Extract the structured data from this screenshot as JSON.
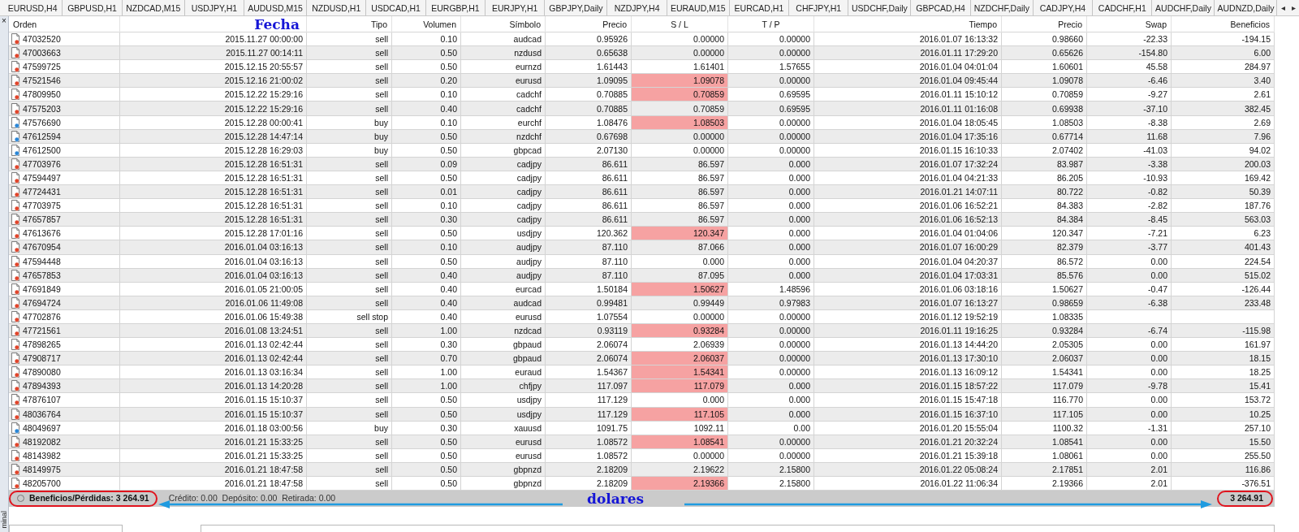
{
  "tabs": [
    {
      "label": "EURUSD,H4"
    },
    {
      "label": "GBPUSD,H1"
    },
    {
      "label": "NZDCAD,M15"
    },
    {
      "label": "USDJPY,H1"
    },
    {
      "label": "AUDUSD,M15"
    },
    {
      "label": "NZDUSD,H1"
    },
    {
      "label": "USDCAD,H1"
    },
    {
      "label": "EURGBP,H1"
    },
    {
      "label": "EURJPY,H1"
    },
    {
      "label": "GBPJPY,Daily"
    },
    {
      "label": "NZDJPY,H4"
    },
    {
      "label": "EURAUD,M15"
    },
    {
      "label": "EURCAD,H1"
    },
    {
      "label": "CHFJPY,H1"
    },
    {
      "label": "USDCHF,Daily"
    },
    {
      "label": "GBPCAD,H4"
    },
    {
      "label": "NZDCHF,Daily"
    },
    {
      "label": "CADJPY,H4"
    },
    {
      "label": "CADCHF,H1"
    },
    {
      "label": "AUDCHF,Daily"
    },
    {
      "label": "AUDNZD,Daily"
    }
  ],
  "tab_scroll": [
    "◂",
    "▸"
  ],
  "panel_close": "×",
  "panel_title": "minal",
  "columns": [
    {
      "label": "Orden",
      "annotated": false
    },
    {
      "label": "Fecha",
      "annotated": true
    },
    {
      "label": "Tipo",
      "annotated": false
    },
    {
      "label": "Volumen",
      "annotated": false
    },
    {
      "label": "Símbolo",
      "annotated": false
    },
    {
      "label": "Precio",
      "annotated": false
    },
    {
      "label": "S / L",
      "annotated": false
    },
    {
      "label": "T / P",
      "annotated": false
    },
    {
      "label": "Tiempo",
      "annotated": false
    },
    {
      "label": "Precio",
      "annotated": false
    },
    {
      "label": "Swap",
      "annotated": false
    },
    {
      "label": "Beneficios",
      "annotated": false
    }
  ],
  "rows": [
    {
      "kind": "sell",
      "sl_highlighted": false,
      "cells": [
        "47032520",
        "2015.11.27 00:00:00",
        "sell",
        "0.10",
        "audcad",
        "0.95926",
        "0.00000",
        "0.00000",
        "2016.01.07 16:13:32",
        "0.98660",
        "-22.33",
        "-194.15"
      ]
    },
    {
      "kind": "sell",
      "sl_highlighted": false,
      "cells": [
        "47003663",
        "2015.11.27 00:14:11",
        "sell",
        "0.50",
        "nzdusd",
        "0.65638",
        "0.00000",
        "0.00000",
        "2016.01.11 17:29:20",
        "0.65626",
        "-154.80",
        "6.00"
      ]
    },
    {
      "kind": "sell",
      "sl_highlighted": false,
      "cells": [
        "47599725",
        "2015.12.15 20:55:57",
        "sell",
        "0.50",
        "eurnzd",
        "1.61443",
        "1.61401",
        "1.57655",
        "2016.01.04 04:01:04",
        "1.60601",
        "45.58",
        "284.97"
      ]
    },
    {
      "kind": "sell",
      "sl_highlighted": true,
      "cells": [
        "47521546",
        "2015.12.16 21:00:02",
        "sell",
        "0.20",
        "eurusd",
        "1.09095",
        "1.09078",
        "0.00000",
        "2016.01.04 09:45:44",
        "1.09078",
        "-6.46",
        "3.40"
      ]
    },
    {
      "kind": "sell",
      "sl_highlighted": true,
      "cells": [
        "47809950",
        "2015.12.22 15:29:16",
        "sell",
        "0.10",
        "cadchf",
        "0.70885",
        "0.70859",
        "0.69595",
        "2016.01.11 15:10:12",
        "0.70859",
        "-9.27",
        "2.61"
      ]
    },
    {
      "kind": "sell",
      "sl_highlighted": false,
      "cells": [
        "47575203",
        "2015.12.22 15:29:16",
        "sell",
        "0.40",
        "cadchf",
        "0.70885",
        "0.70859",
        "0.69595",
        "2016.01.11 01:16:08",
        "0.69938",
        "-37.10",
        "382.45"
      ]
    },
    {
      "kind": "buy",
      "sl_highlighted": true,
      "cells": [
        "47576690",
        "2015.12.28 00:00:41",
        "buy",
        "0.10",
        "eurchf",
        "1.08476",
        "1.08503",
        "0.00000",
        "2016.01.04 18:05:45",
        "1.08503",
        "-8.38",
        "2.69"
      ]
    },
    {
      "kind": "buy",
      "sl_highlighted": false,
      "cells": [
        "47612594",
        "2015.12.28 14:47:14",
        "buy",
        "0.50",
        "nzdchf",
        "0.67698",
        "0.00000",
        "0.00000",
        "2016.01.04 17:35:16",
        "0.67714",
        "11.68",
        "7.96"
      ]
    },
    {
      "kind": "buy",
      "sl_highlighted": false,
      "cells": [
        "47612500",
        "2015.12.28 16:29:03",
        "buy",
        "0.50",
        "gbpcad",
        "2.07130",
        "0.00000",
        "0.00000",
        "2016.01.15 16:10:33",
        "2.07402",
        "-41.03",
        "94.02"
      ]
    },
    {
      "kind": "sell",
      "sl_highlighted": false,
      "cells": [
        "47703976",
        "2015.12.28 16:51:31",
        "sell",
        "0.09",
        "cadjpy",
        "86.611",
        "86.597",
        "0.000",
        "2016.01.07 17:32:24",
        "83.987",
        "-3.38",
        "200.03"
      ]
    },
    {
      "kind": "sell",
      "sl_highlighted": false,
      "cells": [
        "47594497",
        "2015.12.28 16:51:31",
        "sell",
        "0.50",
        "cadjpy",
        "86.611",
        "86.597",
        "0.000",
        "2016.01.04 04:21:33",
        "86.205",
        "-10.93",
        "169.42"
      ]
    },
    {
      "kind": "sell",
      "sl_highlighted": false,
      "cells": [
        "47724431",
        "2015.12.28 16:51:31",
        "sell",
        "0.01",
        "cadjpy",
        "86.611",
        "86.597",
        "0.000",
        "2016.01.21 14:07:11",
        "80.722",
        "-0.82",
        "50.39"
      ]
    },
    {
      "kind": "sell",
      "sl_highlighted": false,
      "cells": [
        "47703975",
        "2015.12.28 16:51:31",
        "sell",
        "0.10",
        "cadjpy",
        "86.611",
        "86.597",
        "0.000",
        "2016.01.06 16:52:21",
        "84.383",
        "-2.82",
        "187.76"
      ]
    },
    {
      "kind": "sell",
      "sl_highlighted": false,
      "cells": [
        "47657857",
        "2015.12.28 16:51:31",
        "sell",
        "0.30",
        "cadjpy",
        "86.611",
        "86.597",
        "0.000",
        "2016.01.06 16:52:13",
        "84.384",
        "-8.45",
        "563.03"
      ]
    },
    {
      "kind": "sell",
      "sl_highlighted": true,
      "cells": [
        "47613676",
        "2015.12.28 17:01:16",
        "sell",
        "0.50",
        "usdjpy",
        "120.362",
        "120.347",
        "0.000",
        "2016.01.04 01:04:06",
        "120.347",
        "-7.21",
        "6.23"
      ]
    },
    {
      "kind": "sell",
      "sl_highlighted": false,
      "cells": [
        "47670954",
        "2016.01.04 03:16:13",
        "sell",
        "0.10",
        "audjpy",
        "87.110",
        "87.066",
        "0.000",
        "2016.01.07 16:00:29",
        "82.379",
        "-3.77",
        "401.43"
      ]
    },
    {
      "kind": "sell",
      "sl_highlighted": false,
      "cells": [
        "47594448",
        "2016.01.04 03:16:13",
        "sell",
        "0.50",
        "audjpy",
        "87.110",
        "0.000",
        "0.000",
        "2016.01.04 04:20:37",
        "86.572",
        "0.00",
        "224.54"
      ]
    },
    {
      "kind": "sell",
      "sl_highlighted": false,
      "cells": [
        "47657853",
        "2016.01.04 03:16:13",
        "sell",
        "0.40",
        "audjpy",
        "87.110",
        "87.095",
        "0.000",
        "2016.01.04 17:03:31",
        "85.576",
        "0.00",
        "515.02"
      ]
    },
    {
      "kind": "sell",
      "sl_highlighted": true,
      "cells": [
        "47691849",
        "2016.01.05 21:00:05",
        "sell",
        "0.40",
        "eurcad",
        "1.50184",
        "1.50627",
        "1.48596",
        "2016.01.06 03:18:16",
        "1.50627",
        "-0.47",
        "-126.44"
      ]
    },
    {
      "kind": "sell",
      "sl_highlighted": false,
      "cells": [
        "47694724",
        "2016.01.06 11:49:08",
        "sell",
        "0.40",
        "audcad",
        "0.99481",
        "0.99449",
        "0.97983",
        "2016.01.07 16:13:27",
        "0.98659",
        "-6.38",
        "233.48"
      ]
    },
    {
      "kind": "sell",
      "sl_highlighted": false,
      "cells": [
        "47702876",
        "2016.01.06 15:49:38",
        "sell stop",
        "0.40",
        "eurusd",
        "1.07554",
        "0.00000",
        "0.00000",
        "2016.01.12 19:52:19",
        "1.08335",
        null,
        null
      ]
    },
    {
      "kind": "sell",
      "sl_highlighted": true,
      "cells": [
        "47721561",
        "2016.01.08 13:24:51",
        "sell",
        "1.00",
        "nzdcad",
        "0.93119",
        "0.93284",
        "0.00000",
        "2016.01.11 19:16:25",
        "0.93284",
        "-6.74",
        "-115.98"
      ]
    },
    {
      "kind": "sell",
      "sl_highlighted": false,
      "cells": [
        "47898265",
        "2016.01.13 02:42:44",
        "sell",
        "0.30",
        "gbpaud",
        "2.06074",
        "2.06939",
        "0.00000",
        "2016.01.13 14:44:20",
        "2.05305",
        "0.00",
        "161.97"
      ]
    },
    {
      "kind": "sell",
      "sl_highlighted": true,
      "cells": [
        "47908717",
        "2016.01.13 02:42:44",
        "sell",
        "0.70",
        "gbpaud",
        "2.06074",
        "2.06037",
        "0.00000",
        "2016.01.13 17:30:10",
        "2.06037",
        "0.00",
        "18.15"
      ]
    },
    {
      "kind": "sell",
      "sl_highlighted": true,
      "cells": [
        "47890080",
        "2016.01.13 03:16:34",
        "sell",
        "1.00",
        "euraud",
        "1.54367",
        "1.54341",
        "0.00000",
        "2016.01.13 16:09:12",
        "1.54341",
        "0.00",
        "18.25"
      ]
    },
    {
      "kind": "sell",
      "sl_highlighted": true,
      "cells": [
        "47894393",
        "2016.01.13 14:20:28",
        "sell",
        "1.00",
        "chfjpy",
        "117.097",
        "117.079",
        "0.000",
        "2016.01.15 18:57:22",
        "117.079",
        "-9.78",
        "15.41"
      ]
    },
    {
      "kind": "sell",
      "sl_highlighted": false,
      "cells": [
        "47876107",
        "2016.01.15 15:10:37",
        "sell",
        "0.50",
        "usdjpy",
        "117.129",
        "0.000",
        "0.000",
        "2016.01.15 15:47:18",
        "116.770",
        "0.00",
        "153.72"
      ]
    },
    {
      "kind": "sell",
      "sl_highlighted": true,
      "cells": [
        "48036764",
        "2016.01.15 15:10:37",
        "sell",
        "0.50",
        "usdjpy",
        "117.129",
        "117.105",
        "0.000",
        "2016.01.15 16:37:10",
        "117.105",
        "0.00",
        "10.25"
      ]
    },
    {
      "kind": "buy",
      "sl_highlighted": false,
      "cells": [
        "48049697",
        "2016.01.18 03:00:56",
        "buy",
        "0.30",
        "xauusd",
        "1091.75",
        "1092.11",
        "0.00",
        "2016.01.20 15:55:04",
        "1100.32",
        "-1.31",
        "257.10"
      ]
    },
    {
      "kind": "sell",
      "sl_highlighted": true,
      "cells": [
        "48192082",
        "2016.01.21 15:33:25",
        "sell",
        "0.50",
        "eurusd",
        "1.08572",
        "1.08541",
        "0.00000",
        "2016.01.21 20:32:24",
        "1.08541",
        "0.00",
        "15.50"
      ]
    },
    {
      "kind": "sell",
      "sl_highlighted": false,
      "cells": [
        "48143982",
        "2016.01.21 15:33:25",
        "sell",
        "0.50",
        "eurusd",
        "1.08572",
        "0.00000",
        "0.00000",
        "2016.01.21 15:39:18",
        "1.08061",
        "0.00",
        "255.50"
      ]
    },
    {
      "kind": "sell",
      "sl_highlighted": false,
      "cells": [
        "48149975",
        "2016.01.21 18:47:58",
        "sell",
        "0.50",
        "gbpnzd",
        "2.18209",
        "2.19622",
        "2.15800",
        "2016.01.22 05:08:24",
        "2.17851",
        "2.01",
        "116.86"
      ]
    },
    {
      "kind": "sell",
      "sl_highlighted": true,
      "cells": [
        "48205700",
        "2016.01.21 18:47:58",
        "sell",
        "0.50",
        "gbpnzd",
        "2.18209",
        "2.19366",
        "2.15800",
        "2016.01.22 11:06:34",
        "2.19366",
        "2.01",
        "-376.51"
      ]
    }
  ],
  "status_bar": {
    "summary": "Beneficios/Pérdidas: 3 264.91",
    "details": "Crédito: 0.00  Depósito: 0.00  Retirada: 0.00",
    "total": "3 264.91"
  },
  "annotation": {
    "label": "dolares"
  }
}
